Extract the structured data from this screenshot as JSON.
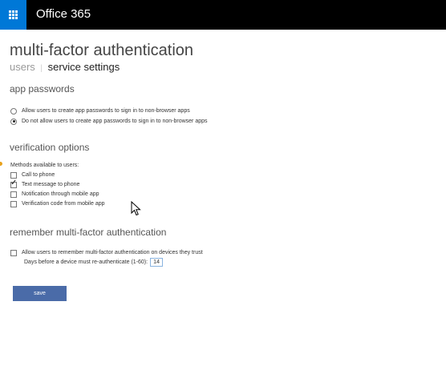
{
  "header": {
    "app_title": "Office 365",
    "app_launcher_icon": "waffle-icon",
    "colors": {
      "bar": "#000000",
      "launcher": "#0078d7"
    }
  },
  "page": {
    "title": "multi-factor authentication",
    "subnav": {
      "users": "users",
      "separator": "|",
      "service_settings": "service settings"
    }
  },
  "app_passwords": {
    "heading": "app passwords",
    "options": [
      {
        "label": "Allow users to create app passwords to sign in to non-browser apps",
        "selected": false
      },
      {
        "label": "Do not allow users to create app passwords to sign in to non-browser apps",
        "selected": true
      }
    ]
  },
  "verification": {
    "heading": "verification options",
    "methods_label": "Methods available to users:",
    "methods": [
      {
        "label": "Call to phone",
        "checked": false
      },
      {
        "label": "Text message to phone",
        "checked": true
      },
      {
        "label": "Notification through mobile app",
        "checked": false
      },
      {
        "label": "Verification code from mobile app",
        "checked": false
      }
    ]
  },
  "remember": {
    "heading": "remember multi-factor authentication",
    "allow_label": "Allow users to remember multi-factor authentication on devices they trust",
    "allow_checked": false,
    "days_label": "Days before a device must re-authenticate (1-60):",
    "days_value": "14"
  },
  "actions": {
    "save_label": "save",
    "save_color": "#4a6ba8"
  }
}
